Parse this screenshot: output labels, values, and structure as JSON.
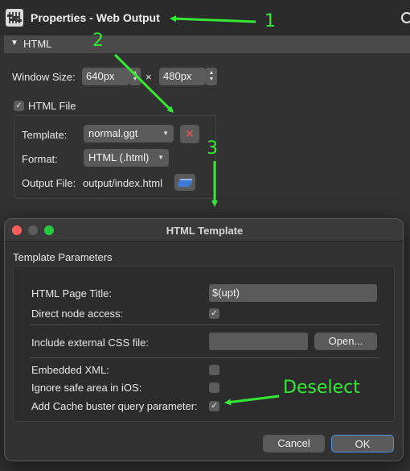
{
  "properties": {
    "title": "Properties - Web Output",
    "section_label": "HTML",
    "window_size_label": "Window Size:",
    "width_value": "640px",
    "times_label": "×",
    "height_value": "480px",
    "html_file_label": "HTML File",
    "html_file_checked": true,
    "template_label": "Template:",
    "template_value": "normal.ggt",
    "format_label": "Format:",
    "format_value": "HTML (.html)",
    "output_file_label": "Output File:",
    "output_file_value": "output/index.html"
  },
  "dialog": {
    "title": "HTML Template",
    "section_label": "Template Parameters",
    "page_title_label": "HTML Page Title:",
    "page_title_value": "$(upt)",
    "direct_node_label": "Direct node access:",
    "direct_node_checked": true,
    "css_label": "Include external CSS file:",
    "css_value": "",
    "open_label": "Open...",
    "embedded_xml_label": "Embedded XML:",
    "embedded_xml_checked": false,
    "safe_area_label": "Ignore safe area in iOS:",
    "safe_area_checked": false,
    "cache_buster_label": "Add Cache buster query parameter:",
    "cache_buster_checked": true,
    "cancel_label": "Cancel",
    "ok_label": "OK"
  },
  "annotations": {
    "one": "1",
    "two": "2",
    "three": "3",
    "deselect": "Deselect",
    "color": "#35e835"
  },
  "check_glyph": "✓",
  "icons": [
    "sliders-icon",
    "link-icon",
    "chevron-down-icon",
    "wrench-screwdriver-icon",
    "folder-icon",
    "stepper-icon",
    "checkbox-icon"
  ]
}
